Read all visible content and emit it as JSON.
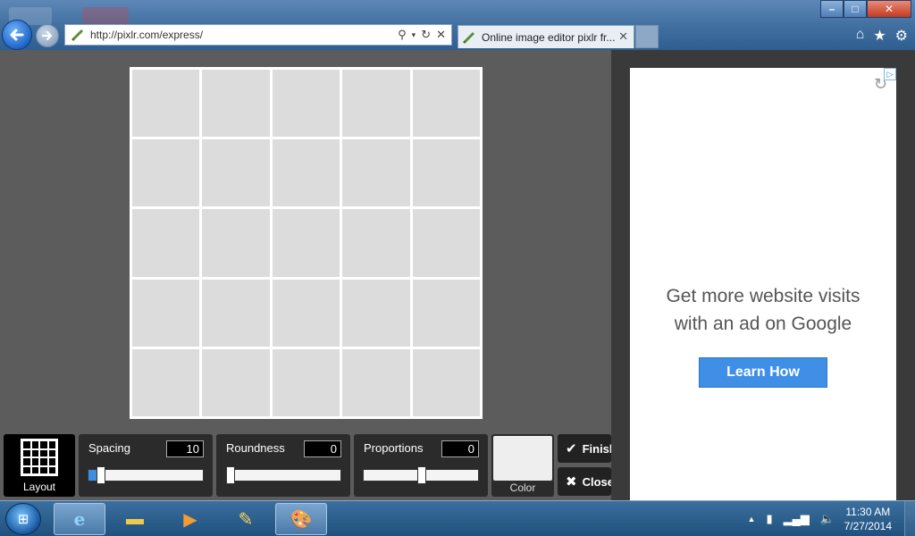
{
  "browser": {
    "url": "http://pixlr.com/express/",
    "tab_title": "Online image editor pixlr fr...",
    "window_controls": {
      "minimize": "–",
      "maximize": "□",
      "close": "✕"
    },
    "nav_icons": [
      "home-icon",
      "star-icon",
      "gear-icon"
    ]
  },
  "editor": {
    "layout_label": "Layout",
    "spacing": {
      "label": "Spacing",
      "value": "10",
      "position": 0.06
    },
    "roundness": {
      "label": "Roundness",
      "value": "0",
      "position": 0.0
    },
    "proportions": {
      "label": "Proportions",
      "value": "0",
      "position": 0.5
    },
    "color_label": "Color",
    "finish_label": "Finish",
    "close_label": "Close"
  },
  "ad": {
    "headline_line1": "Get more website visits",
    "headline_line2": "with an ad on Google",
    "cta": "Learn How"
  },
  "taskbar": {
    "time": "11:30 AM",
    "date": "7/27/2014"
  },
  "colors": {
    "canvas_bg": "#5c5c5c",
    "slider_fill": "#3d8de0",
    "ad_button": "#3f8fe6"
  }
}
